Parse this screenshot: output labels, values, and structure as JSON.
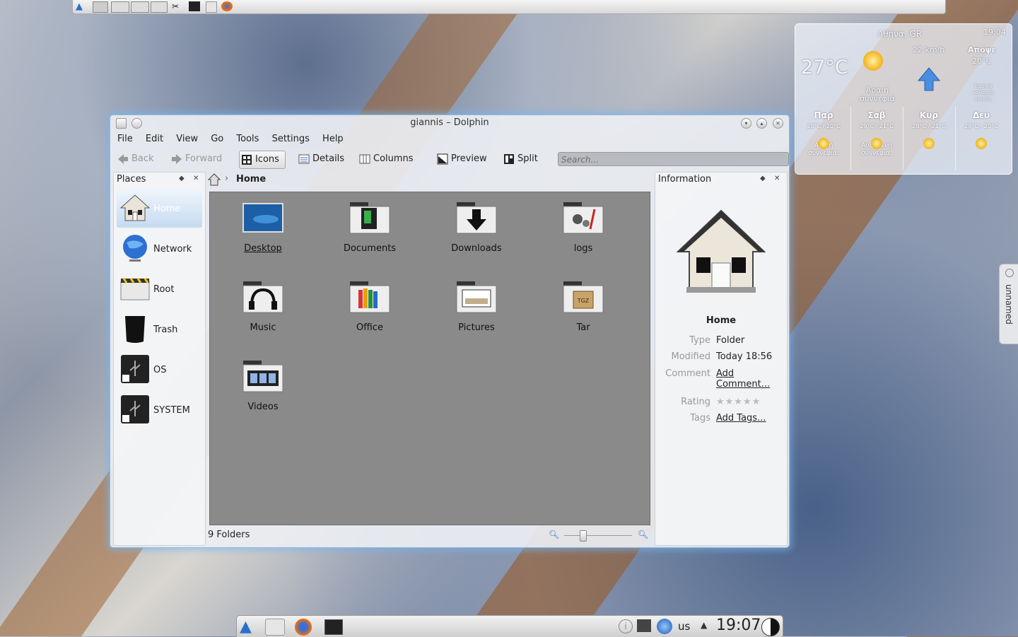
{
  "window": {
    "title": "giannis – Dolphin"
  },
  "menu": [
    "File",
    "Edit",
    "View",
    "Go",
    "Tools",
    "Settings",
    "Help"
  ],
  "toolbar": {
    "back": "Back",
    "forward": "Forward",
    "icons": "Icons",
    "details": "Details",
    "columns": "Columns",
    "preview": "Preview",
    "split": "Split",
    "search_placeholder": "Search..."
  },
  "places": {
    "title": "Places",
    "items": [
      "Home",
      "Network",
      "Root",
      "Trash",
      "OS",
      "SYSTEM"
    ]
  },
  "breadcrumb": {
    "current": "Home"
  },
  "files": [
    "Desktop",
    "Documents",
    "Downloads",
    "logs",
    "Music",
    "Office",
    "Pictures",
    "Tar",
    "Videos"
  ],
  "statusbar": {
    "text": "9 Folders"
  },
  "info": {
    "title": "Information",
    "name": "Home",
    "type_label": "Type",
    "type_value": "Folder",
    "modified_label": "Modified",
    "modified_value": "Today 18:56",
    "comment_label": "Comment",
    "comment_value": "Add Comment...",
    "rating_label": "Rating",
    "rating_stars": 0,
    "tags_label": "Tags",
    "tags_value": "Add Tags..."
  },
  "weather": {
    "location": "Αθήνα, GR",
    "time": "19:04",
    "temperature": "27°C",
    "condition": "Αραιή συννεφιά",
    "wind": "22 km/h",
    "tonight_label": "Απόψε",
    "tonight_temp": "20°C",
    "tonight_desc": "Βασικά καθαρός καιρός",
    "days": [
      {
        "name": "Παρ",
        "temps": "28°C / 20°C",
        "desc": "Αραιή συννεφια."
      },
      {
        "name": "Σαβ",
        "temps": "29°C / 21°C",
        "desc": "Αυξημενη συννεφια."
      },
      {
        "name": "Κυρ",
        "temps": "28°C / 21°C",
        "desc": ""
      },
      {
        "name": "Δευ",
        "temps": "28°C / 20°C",
        "desc": ""
      }
    ]
  },
  "side_tab": {
    "label": "unnamed"
  },
  "tray": {
    "keyboard": "us",
    "clock": "19:07"
  }
}
